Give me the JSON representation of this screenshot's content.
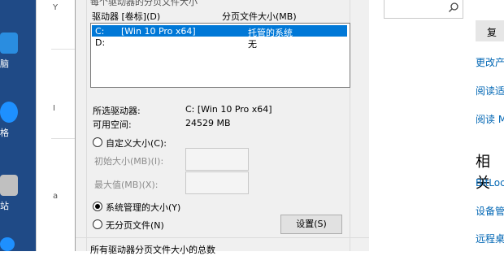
{
  "desktop": {
    "icons": [
      {
        "name": "network-icon",
        "label": "脑",
        "color": "#2a8de0"
      },
      {
        "name": "settings-icon",
        "label": "格",
        "color": "#1e90ff"
      },
      {
        "name": "app-icon",
        "label": "站",
        "color": "#c0c0c0"
      }
    ]
  },
  "background_window": {
    "mark_1": "Y",
    "mark_2": "I",
    "mark_3": "a"
  },
  "dialog": {
    "top_cut_text": "每个驱动器的分页文件大小",
    "list": {
      "col_drive": "驱动器 [卷标](D)",
      "col_size": "分页文件大小(MB)",
      "rows": [
        {
          "drive": "C:",
          "label": "[Win 10 Pro x64]",
          "size": "托管的系统",
          "selected": true
        },
        {
          "drive": "D:",
          "label": "",
          "size": "无",
          "selected": false
        }
      ]
    },
    "selected_drive_label": "所选驱动器:",
    "selected_drive_value": "C:  [Win 10 Pro x64]",
    "free_space_label": "可用空间:",
    "free_space_value": "24529 MB",
    "custom_size": "自定义大小(C):",
    "initial_size": "初始大小(MB)(I):",
    "max_size": "最大值(MB)(X):",
    "system_managed": "系统管理的大小(Y)",
    "no_paging": "无分页文件(N)",
    "set_button": "设置(S)",
    "bottom_cut_text": "所有驱动器分页文件大小的总数"
  },
  "right_panel": {
    "copy_button": "复",
    "links": [
      "更改产",
      "阅读适",
      "阅读 M"
    ],
    "related_heading": "相关",
    "related_links": [
      "BitLock",
      "设备管",
      "远程桌"
    ],
    "search_icon": "search-icon"
  }
}
